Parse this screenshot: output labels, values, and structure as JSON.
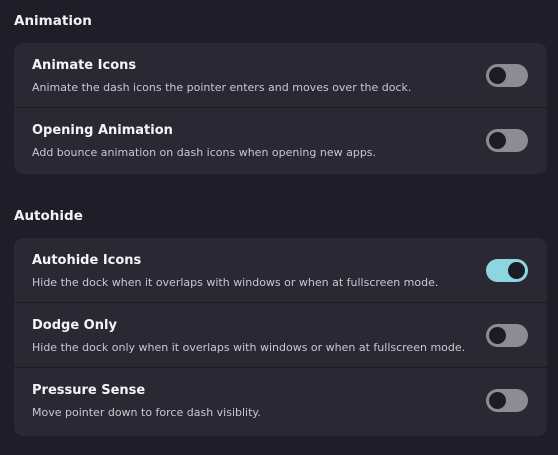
{
  "sections": {
    "animation": {
      "title": "Animation",
      "rows": [
        {
          "title": "Animate Icons",
          "subtitle": "Animate the dash icons the pointer enters and moves over the dock.",
          "toggle": "off"
        },
        {
          "title": "Opening Animation",
          "subtitle": "Add bounce animation on dash icons when opening new apps.",
          "toggle": "off"
        }
      ]
    },
    "autohide": {
      "title": "Autohide",
      "rows": [
        {
          "title": "Autohide Icons",
          "subtitle": "Hide the dock when it overlaps with windows or when at fullscreen mode.",
          "toggle": "on"
        },
        {
          "title": "Dodge Only",
          "subtitle": "Hide the dock only when it overlaps with windows or when at fullscreen mode.",
          "toggle": "off"
        },
        {
          "title": "Pressure Sense",
          "subtitle": "Move pointer down to force dash visiblity.",
          "toggle": "off"
        }
      ]
    }
  },
  "colors": {
    "background": "#1f1d27",
    "card": "#2a2833",
    "switch_on": "#8ed5e2",
    "switch_off": "#8e8c93"
  }
}
